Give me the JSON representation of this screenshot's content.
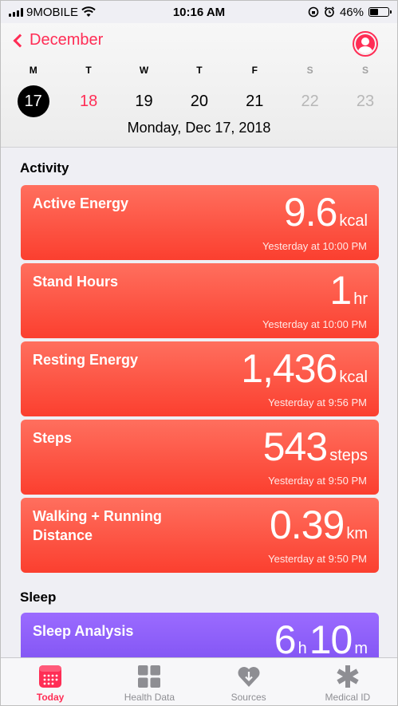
{
  "status": {
    "carrier": "9MOBILE",
    "time": "10:16 AM",
    "battery": "46%",
    "battery_level": 0.46
  },
  "header": {
    "back_label": "December",
    "week": [
      {
        "letter": "M",
        "num": "17",
        "state": "selected"
      },
      {
        "letter": "T",
        "num": "18",
        "state": "today"
      },
      {
        "letter": "W",
        "num": "19",
        "state": ""
      },
      {
        "letter": "T",
        "num": "20",
        "state": ""
      },
      {
        "letter": "F",
        "num": "21",
        "state": ""
      },
      {
        "letter": "S",
        "num": "22",
        "state": "weekend"
      },
      {
        "letter": "S",
        "num": "23",
        "state": "weekend"
      }
    ],
    "date_line": "Monday, Dec 17, 2018"
  },
  "sections": {
    "activity": "Activity",
    "sleep": "Sleep"
  },
  "activity_cards": [
    {
      "title": "Active Energy",
      "value": "9.6",
      "unit": "kcal",
      "time": "Yesterday at 10:00 PM"
    },
    {
      "title": "Stand Hours",
      "value": "1",
      "unit": "hr",
      "time": "Yesterday at 10:00 PM"
    },
    {
      "title": "Resting Energy",
      "value": "1,436",
      "unit": "kcal",
      "time": "Yesterday at 9:56 PM"
    },
    {
      "title": "Steps",
      "value": "543",
      "unit": "steps",
      "time": "Yesterday at 9:50 PM"
    },
    {
      "title": "Walking + Running Distance",
      "value": "0.39",
      "unit": "km",
      "time": "Yesterday at 9:50 PM"
    }
  ],
  "sleep_card": {
    "title": "Sleep Analysis",
    "hours": "6",
    "hours_unit": "h",
    "minutes": "10",
    "minutes_unit": "m"
  },
  "tabs": [
    {
      "label": "Today",
      "icon": "calendar-icon",
      "active": true
    },
    {
      "label": "Health Data",
      "icon": "grid-icon",
      "active": false
    },
    {
      "label": "Sources",
      "icon": "heart-download-icon",
      "active": false
    },
    {
      "label": "Medical ID",
      "icon": "asterisk-icon",
      "active": false
    }
  ],
  "colors": {
    "accent": "#ff2d55",
    "activity": "#fb4a3a",
    "sleep": "#8a5cf6"
  }
}
